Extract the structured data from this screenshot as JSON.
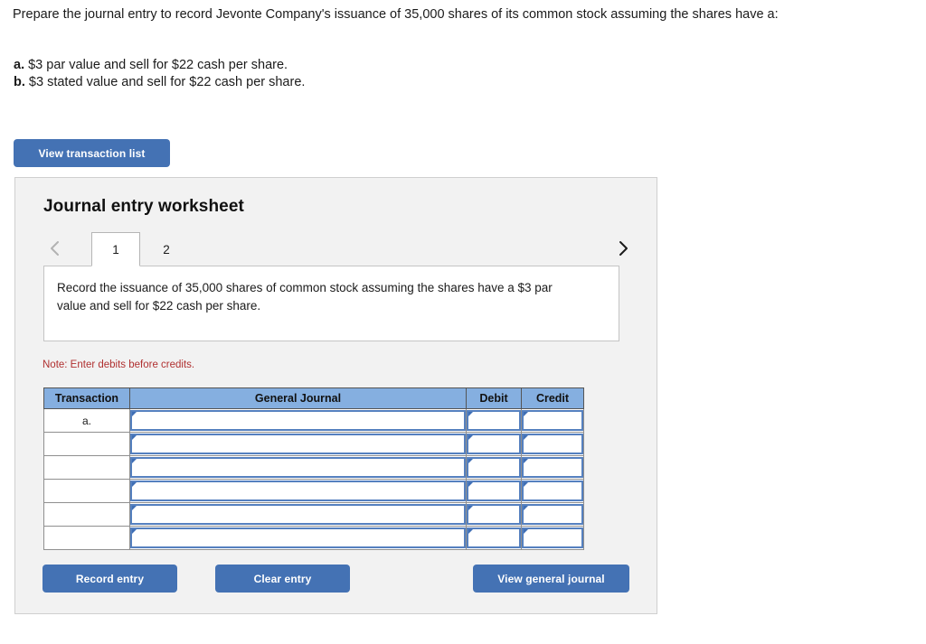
{
  "question": {
    "stem": "Prepare the journal entry to record Jevonte Company's issuance of 35,000 shares of its common stock assuming the shares have a:",
    "choices": [
      {
        "key": "a.",
        "text": " $3 par value and sell for $22 cash per share."
      },
      {
        "key": "b.",
        "text": " $3 stated value and sell for $22 cash per share."
      }
    ]
  },
  "toolbar": {
    "view_transaction_list_label": "View transaction list"
  },
  "worksheet": {
    "title": "Journal entry worksheet",
    "nav": {
      "prev_icon": "chevron-left-icon",
      "next_icon": "chevron-right-icon"
    },
    "tabs": [
      {
        "label": "1",
        "active": true
      },
      {
        "label": "2",
        "active": false
      }
    ],
    "instruction": "Record the issuance of 35,000 shares of common stock assuming the shares have a $3 par value and sell for $22 cash per share.",
    "note": "Note: Enter debits before credits.",
    "table": {
      "headers": [
        "Transaction",
        "General Journal",
        "Debit",
        "Credit"
      ],
      "rows": [
        {
          "transaction": "a.",
          "general_journal": "",
          "debit": "",
          "credit": ""
        },
        {
          "transaction": "",
          "general_journal": "",
          "debit": "",
          "credit": ""
        },
        {
          "transaction": "",
          "general_journal": "",
          "debit": "",
          "credit": ""
        },
        {
          "transaction": "",
          "general_journal": "",
          "debit": "",
          "credit": ""
        },
        {
          "transaction": "",
          "general_journal": "",
          "debit": "",
          "credit": ""
        },
        {
          "transaction": "",
          "general_journal": "",
          "debit": "",
          "credit": ""
        }
      ]
    },
    "footer": {
      "record_label": "Record entry",
      "clear_label": "Clear entry",
      "view_journal_label": "View general journal"
    }
  },
  "colors": {
    "button_blue": "#4472b4",
    "table_header_blue": "#85afe0",
    "field_border_blue": "#5580bf",
    "note_red": "#b03030",
    "panel_gray": "#f2f2f2"
  }
}
